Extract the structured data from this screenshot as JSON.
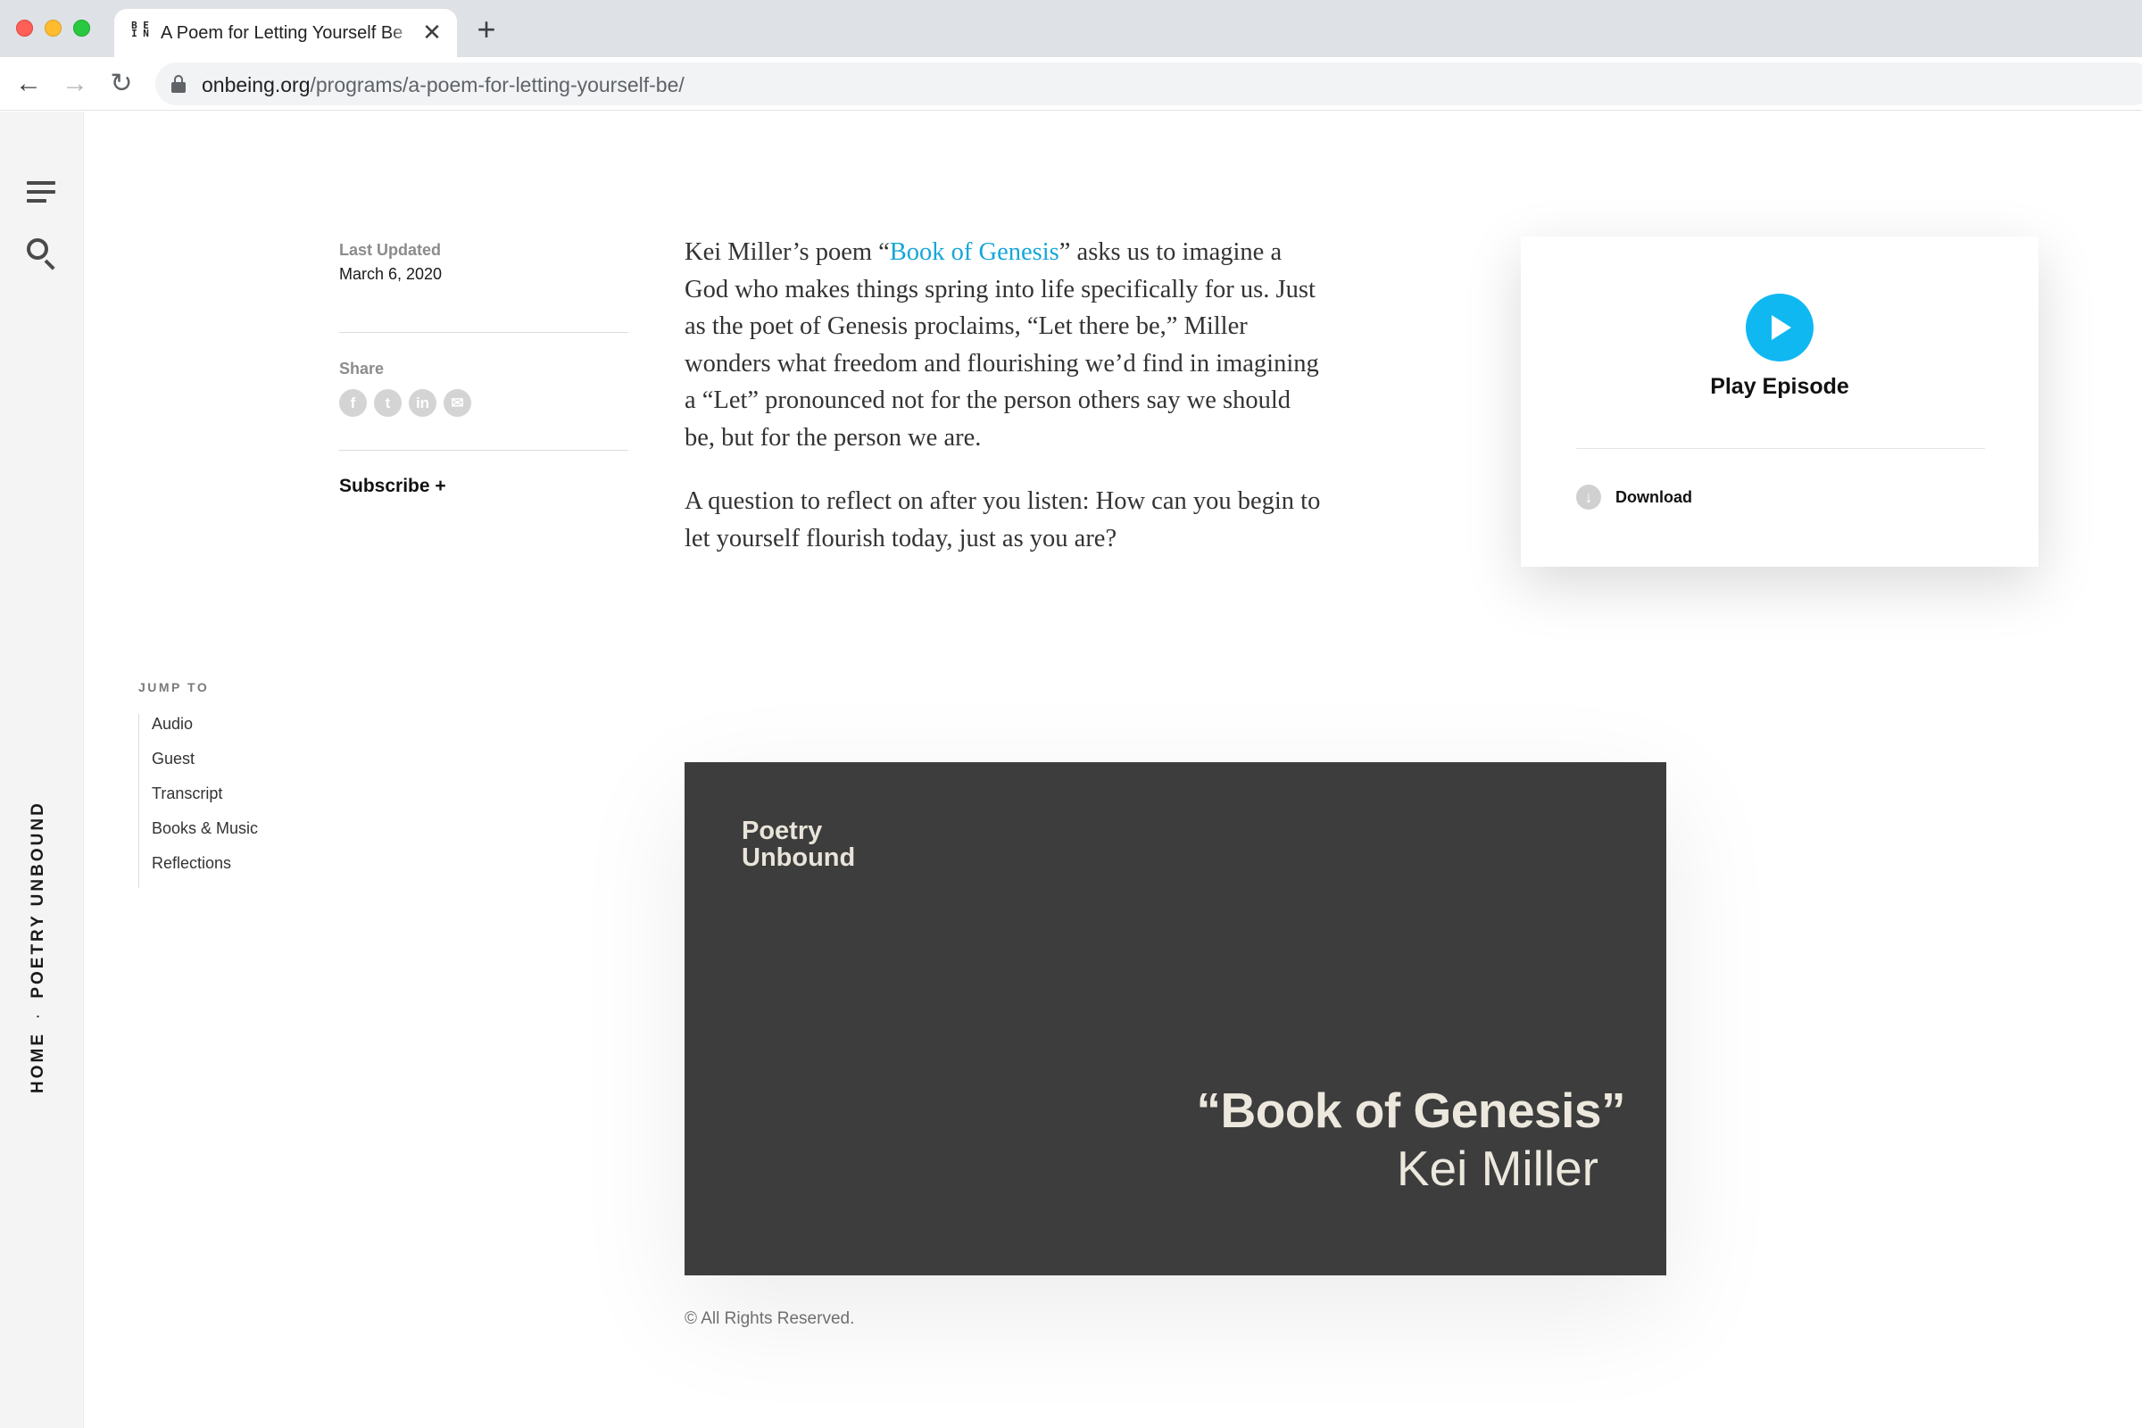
{
  "browser": {
    "tab_title": "A Poem for Letting Yourself Be",
    "favicon_text": "B E I N",
    "tab_close": "✕",
    "new_tab": "+",
    "url_domain": "onbeing.org",
    "url_path": "/programs/a-poem-for-letting-yourself-be/",
    "nav": {
      "back": "←",
      "forward": "→",
      "reload": "↻"
    }
  },
  "rail": {
    "crumb_home": "HOME",
    "crumb_sep": "·",
    "crumb_section": "POETRY UNBOUND"
  },
  "meta": {
    "updated_label": "Last Updated",
    "updated_date": "March 6, 2020",
    "share_label": "Share",
    "share_icons": [
      "f",
      "t",
      "in",
      "✉"
    ],
    "subscribe": "Subscribe +"
  },
  "body": {
    "p1_before": "Kei Miller’s poem “",
    "p1_link": "Book of Genesis",
    "p1_after": "” asks us to imagine a God who makes things spring into life specifically for us. Just as the poet of Genesis proclaims, “Let there be,” Miller wonders what freedom and flourishing we’d find in imagining a “Let” pronounced not for the person others say we should be, but for the person we are.",
    "p2": "A question to reflect on after you listen: How can you begin to let yourself flourish today, just as you are?"
  },
  "episode_card": {
    "play_label": "Play Episode",
    "download_label": "Download",
    "download_glyph": "↓"
  },
  "jump_to": {
    "heading": "JUMP TO",
    "items": [
      "Audio",
      "Guest",
      "Transcript",
      "Books & Music",
      "Reflections"
    ]
  },
  "hero": {
    "brand_line1": "Poetry",
    "brand_line2": "Unbound",
    "title": "“Book of Genesis”",
    "author": "Kei Miller",
    "caption": "© All Rights Reserved."
  },
  "colors": {
    "accent": "#16a6d9",
    "play_button": "#10b8f2",
    "hero_bg": "#3d3d3d"
  }
}
